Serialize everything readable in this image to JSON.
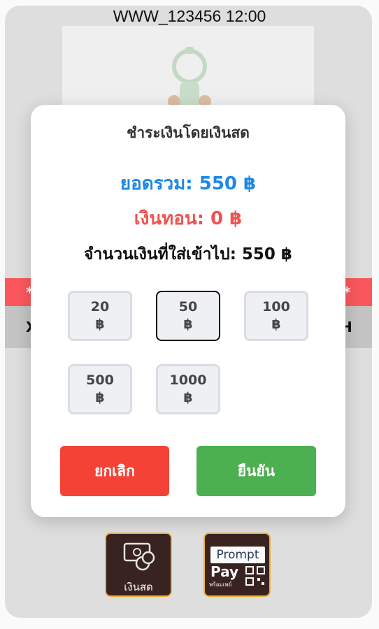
{
  "header": {
    "title": "WWW_123456 12:00"
  },
  "background": {
    "band_left_char": "X",
    "band_right_char": "H",
    "band_star": "*"
  },
  "payment_methods": [
    {
      "label": "เงินสด",
      "icon": "cash-icon"
    },
    {
      "label_top": "Prompt",
      "label_main": "Pay",
      "label_sub": "พร้อมเพย์",
      "icon": "promptpay-qr-icon"
    }
  ],
  "modal": {
    "title": "ชำระเงินโดยเงินสด",
    "total": "ยอดรวม: 550 ฿",
    "change": "เงินทอน: 0 ฿",
    "inserted": "จำนวนเงินที่ใส่เข้าไป: 550 ฿",
    "denominations": [
      {
        "value": "20",
        "currency": "฿",
        "selected": false
      },
      {
        "value": "50",
        "currency": "฿",
        "selected": true
      },
      {
        "value": "100",
        "currency": "฿",
        "selected": false
      },
      {
        "value": "500",
        "currency": "฿",
        "selected": false
      },
      {
        "value": "1000",
        "currency": "฿",
        "selected": false
      }
    ],
    "cancel_label": "ยกเลิก",
    "confirm_label": "ยืนยัน"
  },
  "colors": {
    "total": "#1e88e5",
    "change": "#ef5350",
    "cancel": "#f44336",
    "confirm": "#4caf50"
  }
}
